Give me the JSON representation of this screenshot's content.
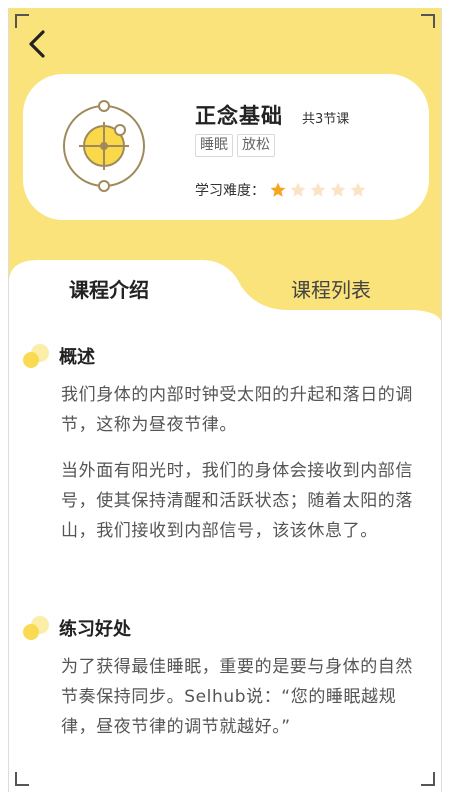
{
  "header": {
    "back_icon": "chevron-left-icon"
  },
  "course": {
    "logo_icon": "sun-orbit-icon",
    "title": "正念基础",
    "lesson_count": "共3节课",
    "tags": [
      "睡眠",
      "放松"
    ],
    "difficulty_label": "学习难度：",
    "difficulty_rating": 1,
    "difficulty_max": 5
  },
  "tabs": {
    "intro_label": "课程介绍",
    "list_label": "课程列表"
  },
  "sections": {
    "overview_title": "概述",
    "overview_p1": "我们身体的内部时钟受太阳的升起和落日的调节，这称为昼夜节律。",
    "overview_p2": "当外面有阳光时，我们的身体会接收到内部信号，使其保持清醒和活跃状态；随着太阳的落山，我们接收到内部信号，该该休息了。",
    "benefits_title": "练习好处",
    "benefits_p1": "为了获得最佳睡眠，重要的是要与身体的自然节奏保持同步。Selhub说：“您的睡眠越规律，昼夜节律的调节就越好。”"
  },
  "colors": {
    "accent_yellow": "#fae37a",
    "star_active": "#f5a623",
    "star_inactive": "#fbe3c6",
    "logo_brown": "#a08a5c"
  }
}
